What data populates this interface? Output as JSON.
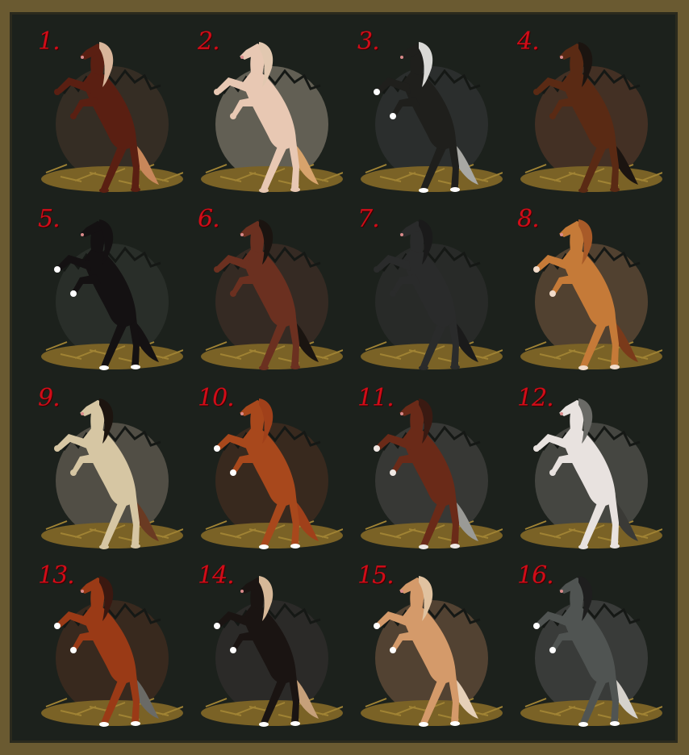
{
  "colors": {
    "frame": "#6a5a31",
    "background": "#1c211c",
    "number": "#d10c18",
    "straw": "#7a6226"
  },
  "horses": [
    {
      "label": "1.",
      "coat": "#5a1f12",
      "mane": "#d8b59a",
      "tail": "#c8875a",
      "egg": "#3a2f26",
      "markings": "#5a1f12"
    },
    {
      "label": "2.",
      "coat": "#e8c8b3",
      "mane": "#e2c8b0",
      "tail": "#d7a36c",
      "egg": "#6e6a5e",
      "markings": "#e8c8b3"
    },
    {
      "label": "3.",
      "coat": "#1f1f1c",
      "mane": "#d9d9d6",
      "tail": "#a8a8a4",
      "egg": "#2e3030",
      "markings": "#ffffff"
    },
    {
      "label": "4.",
      "coat": "#5a2a14",
      "mane": "#1b1410",
      "tail": "#1b1410",
      "egg": "#4a3326",
      "markings": "#5a2a14"
    },
    {
      "label": "5.",
      "coat": "#141112",
      "mane": "#141112",
      "tail": "#141112",
      "egg": "#2c302c",
      "markings": "#ffffff"
    },
    {
      "label": "6.",
      "coat": "#6b3020",
      "mane": "#1a1410",
      "tail": "#1a1410",
      "egg": "#3a2c24",
      "markings": "#6b3020"
    },
    {
      "label": "7.",
      "coat": "#2a2b2b",
      "mane": "#1a1a1a",
      "tail": "#1a1a1a",
      "egg": "#2a2c2a",
      "markings": "#2a2b2b"
    },
    {
      "label": "8.",
      "coat": "#c57a38",
      "mane": "#a85a28",
      "tail": "#7a3a1a",
      "egg": "#5a4634",
      "markings": "#f2dccb"
    },
    {
      "label": "9.",
      "coat": "#d6c6a3",
      "mane": "#1c140f",
      "tail": "#6a3a22",
      "egg": "#5a564c",
      "markings": "#d6c6a3"
    },
    {
      "label": "10.",
      "coat": "#a8481c",
      "mane": "#a0401a",
      "tail": "#a0401a",
      "egg": "#3d2a1f",
      "markings": "#ffffff"
    },
    {
      "label": "11.",
      "coat": "#6a2a18",
      "mane": "#3a1a12",
      "tail": "#9a9a96",
      "egg": "#3c3c3a",
      "markings": "#efe8e4"
    },
    {
      "label": "12.",
      "coat": "#e8e2df",
      "mane": "#6a6a66",
      "tail": "#3a3a36",
      "egg": "#4c4c48",
      "markings": "#e8e2df"
    },
    {
      "label": "13.",
      "coat": "#9a3a16",
      "mane": "#3a1810",
      "tail": "#6a6a66",
      "egg": "#3d2a1f",
      "markings": "#ffffff"
    },
    {
      "label": "14.",
      "coat": "#1a1412",
      "mane": "#d6b898",
      "tail": "#c6a07a",
      "egg": "#2e2c2a",
      "markings": "#ffffff"
    },
    {
      "label": "15.",
      "coat": "#d49a6a",
      "mane": "#e0c2a0",
      "tail": "#e6d0b8",
      "egg": "#5c4836",
      "markings": "#ffffff"
    },
    {
      "label": "16.",
      "coat": "#505452",
      "mane": "#1e1e1e",
      "tail": "#d6d2cc",
      "egg": "#3e403e",
      "markings": "#ffffff"
    }
  ]
}
